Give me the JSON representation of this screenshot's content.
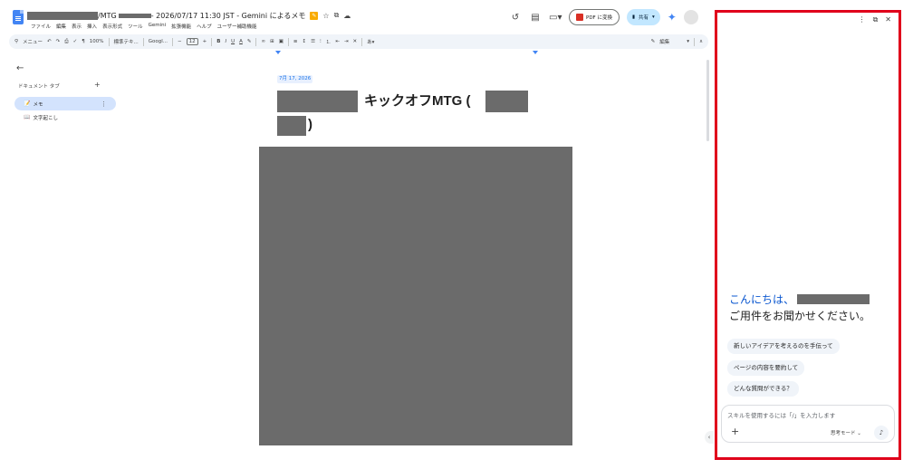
{
  "header": {
    "title_text": "/MTG",
    "title_suffix": "- 2026/07/17 11:30 JST - Gemini によるメモ",
    "star": "☆",
    "menus": [
      "ファイル",
      "編集",
      "表示",
      "挿入",
      "表示形式",
      "ツール",
      "Gemini",
      "拡張機能",
      "ヘルプ",
      "ユーザー補助機能"
    ],
    "pdf_label": "PDF に変換",
    "share_label": "共有"
  },
  "toolbar": {
    "menu_search": "メニュー",
    "zoom": "100%",
    "style": "標準テキ...",
    "font": "Googl...",
    "font_size": "12",
    "bold": "B",
    "italic": "I",
    "underline": "U",
    "text_color": "A",
    "edit_label": "編集"
  },
  "outline": {
    "tabs_title": "ドキュメント タブ",
    "tabs": [
      {
        "label": "メモ",
        "emoji": "📝"
      },
      {
        "label": "文字起こし",
        "emoji": "📖"
      }
    ]
  },
  "document": {
    "date": "7月 17, 2026",
    "title_part1": "キックオフMTG (",
    "title_part2": ")"
  },
  "gemini": {
    "greeting": "こんにちは、",
    "subtitle": "ご用件をお聞かせください。",
    "suggestions": [
      "新しいアイデアを考えるのを手伝って",
      "ページの内容を要約して",
      "どんな質問ができる？"
    ],
    "input_placeholder": "スキルを使用するには「/」を入力します",
    "mode_label": "思考モード"
  }
}
